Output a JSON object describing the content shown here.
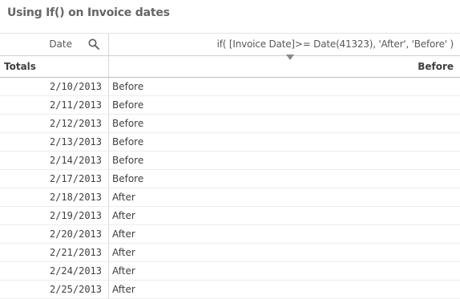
{
  "title": "Using If() on Invoice dates",
  "header": {
    "dimension_label": "Date",
    "measure_label": "if( [Invoice Date]>= Date(41323), 'After', 'Before' )"
  },
  "totals": {
    "label": "Totals",
    "value": "Before"
  },
  "rows": [
    {
      "date": "2/10/2013",
      "value": "Before"
    },
    {
      "date": "2/11/2013",
      "value": "Before"
    },
    {
      "date": "2/12/2013",
      "value": "Before"
    },
    {
      "date": "2/13/2013",
      "value": "Before"
    },
    {
      "date": "2/14/2013",
      "value": "Before"
    },
    {
      "date": "2/17/2013",
      "value": "Before"
    },
    {
      "date": "2/18/2013",
      "value": "After"
    },
    {
      "date": "2/19/2013",
      "value": "After"
    },
    {
      "date": "2/20/2013",
      "value": "After"
    },
    {
      "date": "2/21/2013",
      "value": "After"
    },
    {
      "date": "2/24/2013",
      "value": "After"
    },
    {
      "date": "2/25/2013",
      "value": "After"
    }
  ],
  "icons": {
    "search": "search-icon",
    "sort": "sort-descending-icon"
  }
}
